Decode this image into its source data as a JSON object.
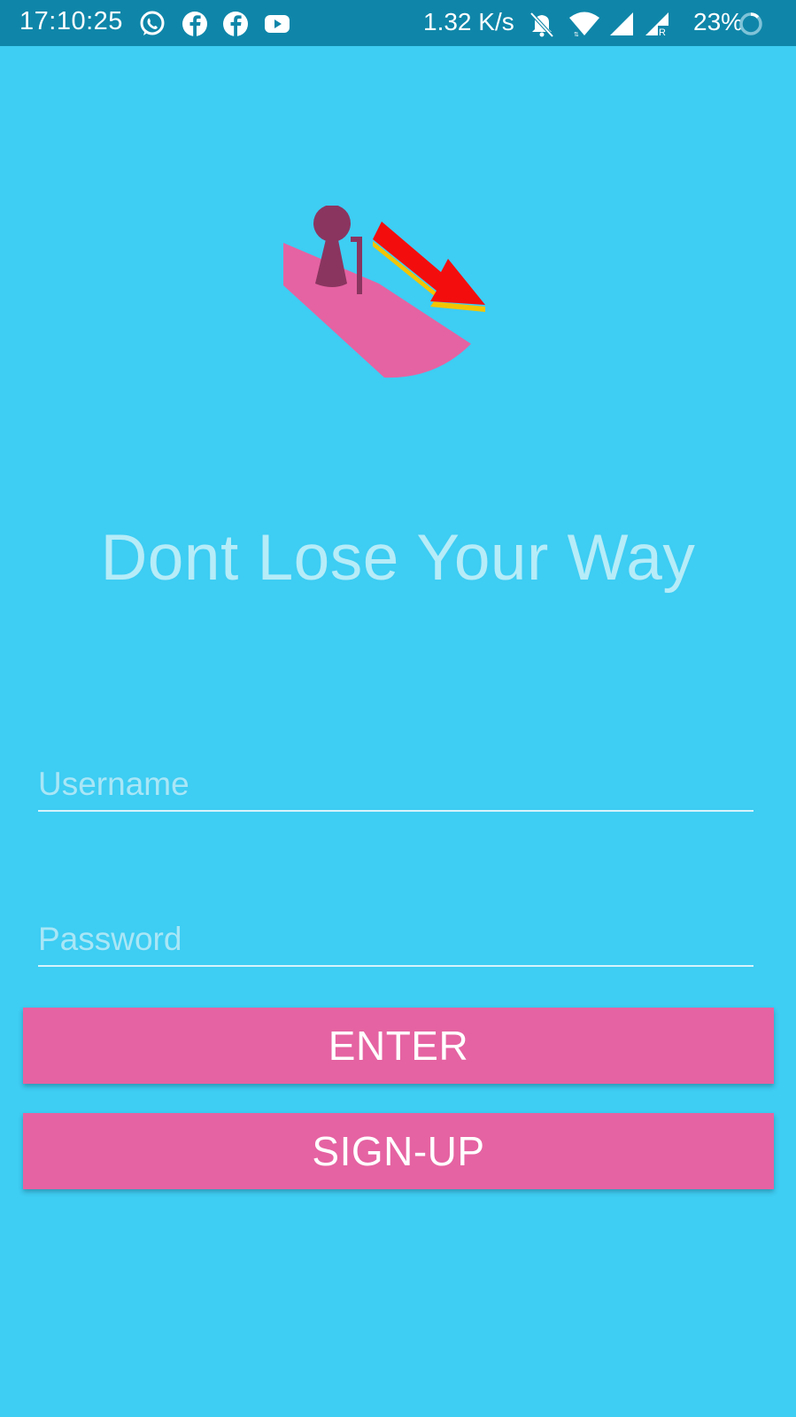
{
  "status_bar": {
    "time": "17:10:25",
    "network_speed": "1.32 K/s",
    "battery_percent": "23%",
    "notification_icons": [
      "whatsapp-icon",
      "facebook-icon",
      "facebook-icon",
      "youtube-icon"
    ],
    "system_icons": [
      "bell-off-icon",
      "wifi-icon",
      "cell-signal-icon",
      "cell-signal-roaming-icon",
      "battery-ring-icon"
    ]
  },
  "app": {
    "title": "Dont Lose Your Way"
  },
  "form": {
    "username_placeholder": "Username",
    "username_value": "",
    "password_placeholder": "Password",
    "password_value": ""
  },
  "buttons": {
    "enter_label": "ENTER",
    "signup_label": "SIGN-UP"
  },
  "colors": {
    "background": "#3ecdf3",
    "status_bar": "#0f86a9",
    "button": "#e563a2",
    "title_text": "#b6ecf8"
  }
}
